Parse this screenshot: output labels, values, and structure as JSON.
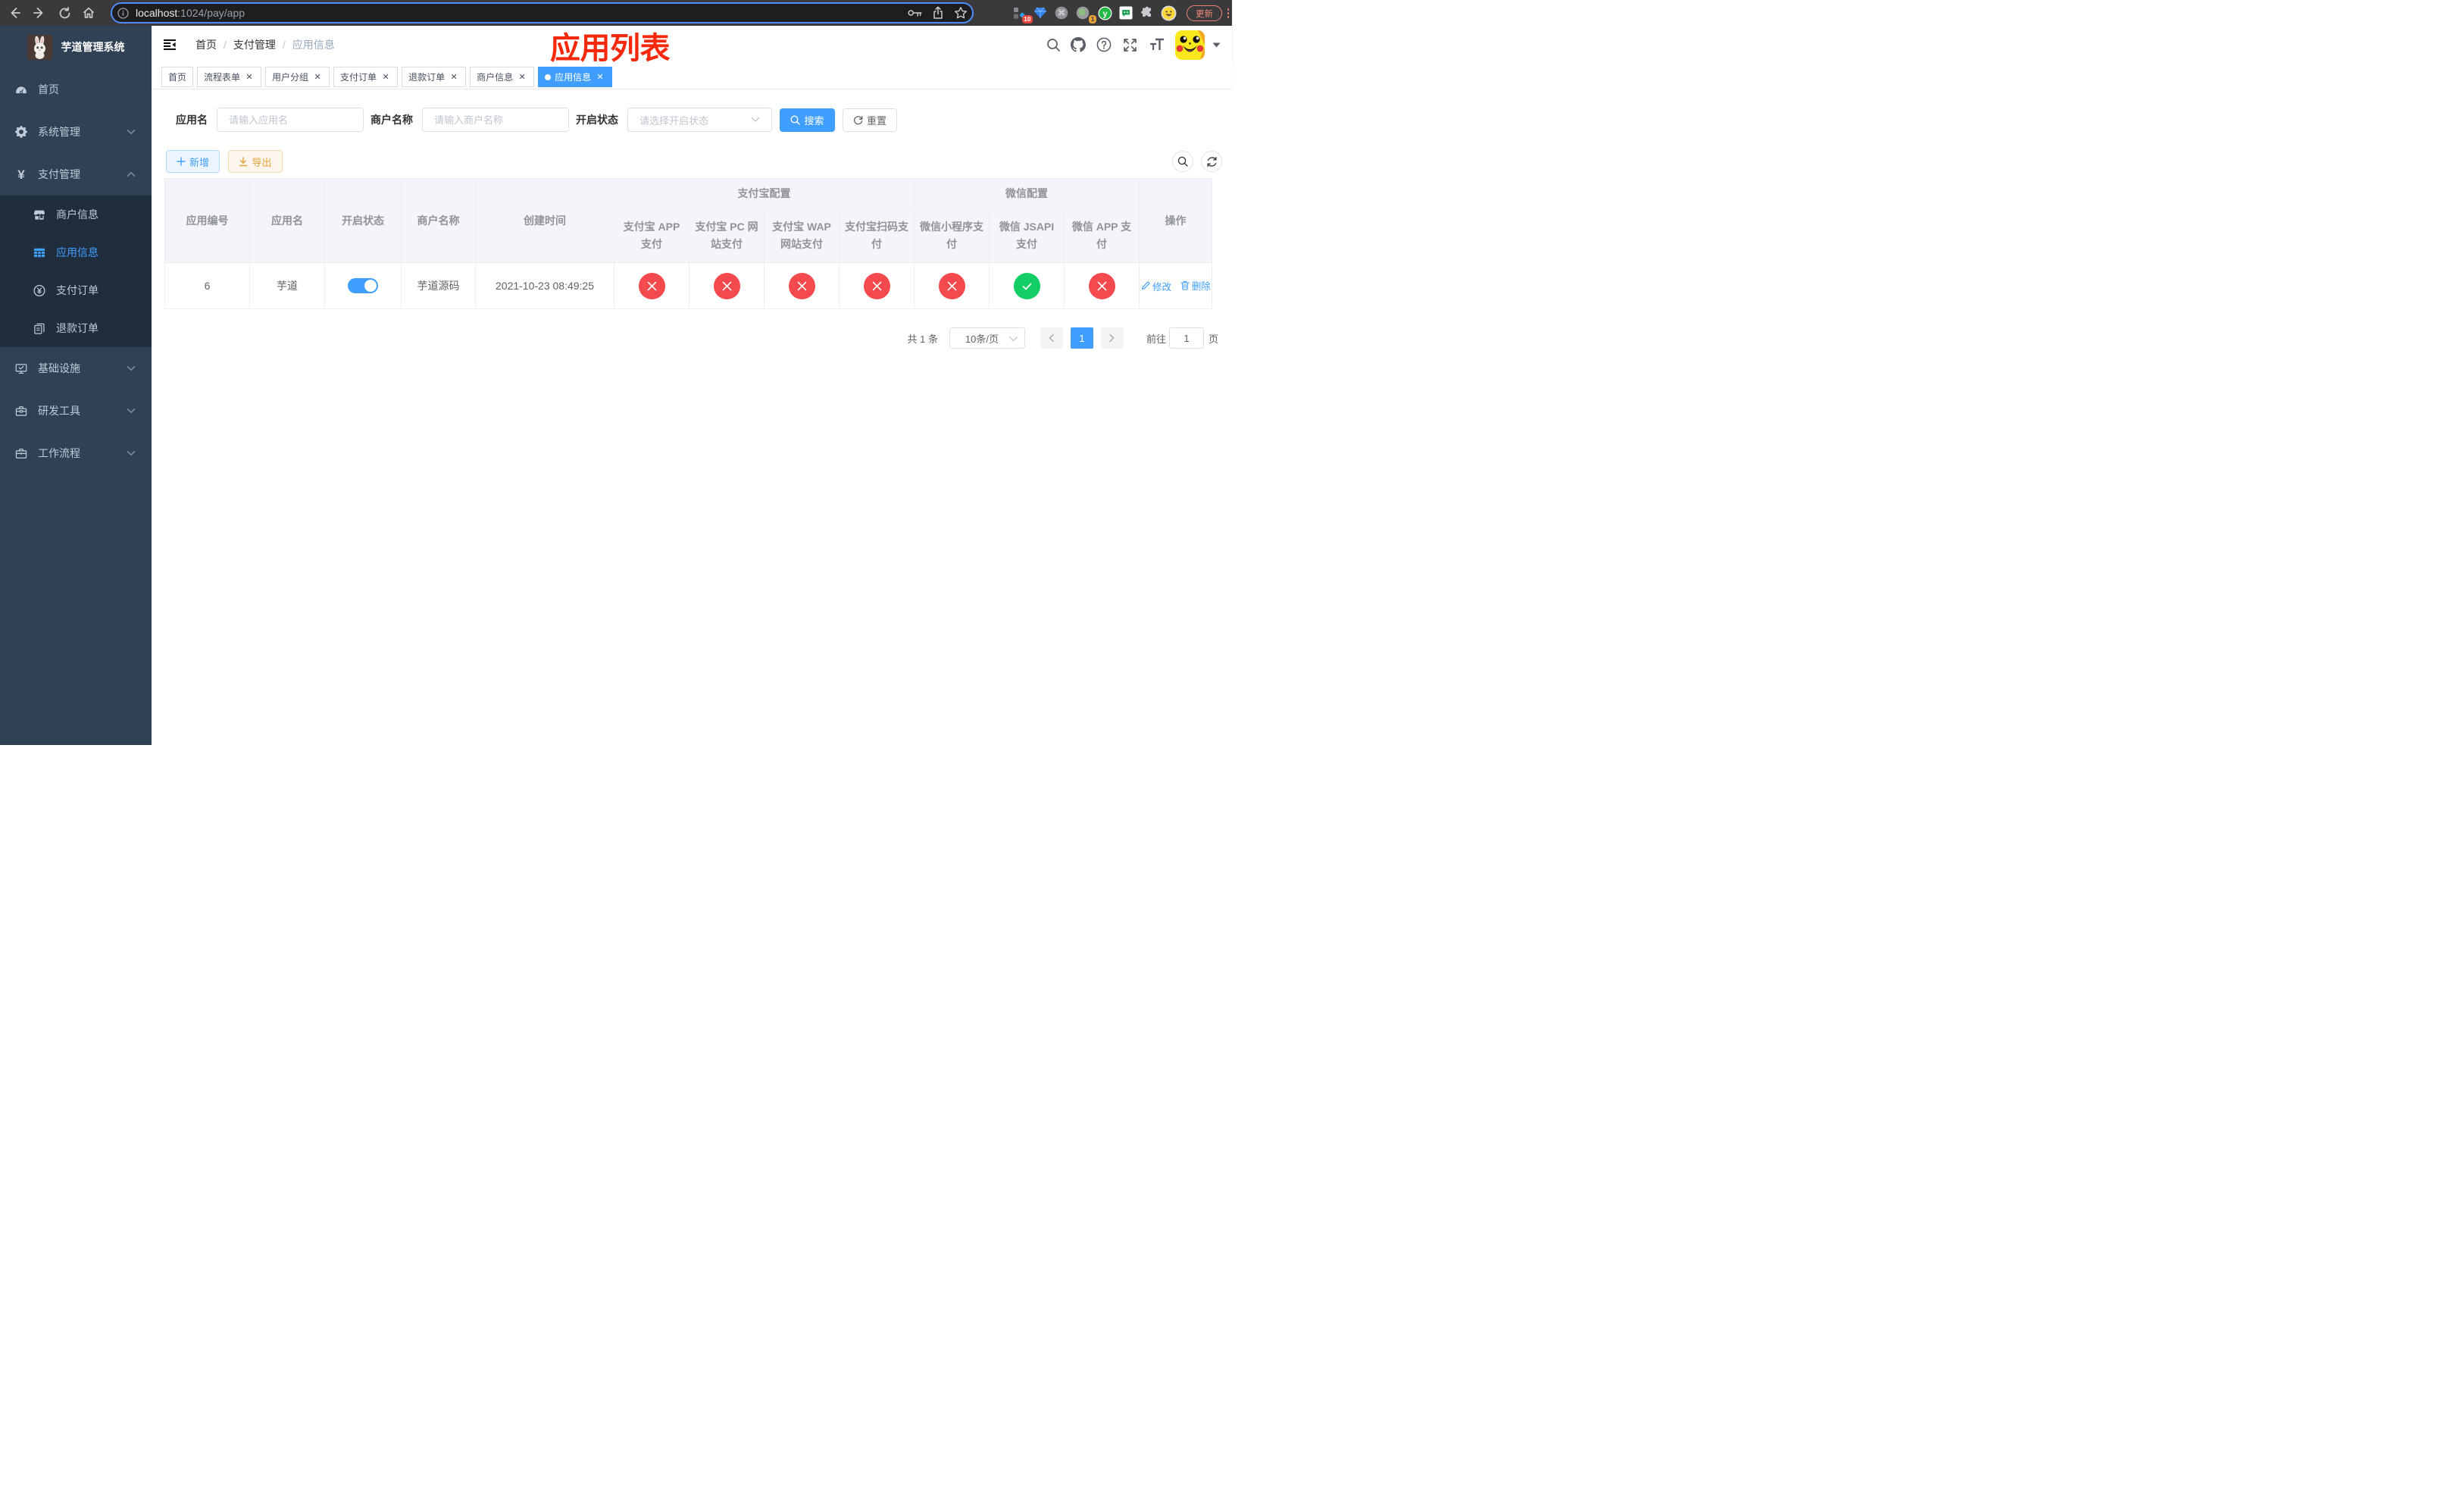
{
  "chrome": {
    "url_host": "localhost",
    "url_path": ":1024/pay/app",
    "ext_badge_red": "10",
    "ext_badge_orange": "1",
    "update_label": "更新"
  },
  "header": {
    "breadcrumb": [
      "首页",
      "支付管理",
      "应用信息"
    ],
    "annotation": "应用列表"
  },
  "sidebar": {
    "title": "芋道管理系统",
    "menu": [
      {
        "label": "首页",
        "icon": "dashboard-icon"
      },
      {
        "label": "系统管理",
        "icon": "gear-icon",
        "arrow": "down"
      },
      {
        "label": "支付管理",
        "icon": "yen-icon",
        "arrow": "up",
        "children": [
          {
            "label": "商户信息",
            "icon": "shop-icon"
          },
          {
            "label": "应用信息",
            "icon": "grid-icon",
            "active": true
          },
          {
            "label": "支付订单",
            "icon": "yen-circle-icon"
          },
          {
            "label": "退款订单",
            "icon": "document-icon"
          }
        ]
      },
      {
        "label": "基础设施",
        "icon": "monitor-icon",
        "arrow": "down"
      },
      {
        "label": "研发工具",
        "icon": "toolbox-icon",
        "arrow": "down"
      },
      {
        "label": "工作流程",
        "icon": "briefcase-icon",
        "arrow": "down"
      }
    ]
  },
  "tags": [
    {
      "label": "首页",
      "closable": false,
      "active": false
    },
    {
      "label": "流程表单",
      "closable": true,
      "active": false
    },
    {
      "label": "用户分组",
      "closable": true,
      "active": false
    },
    {
      "label": "支付订单",
      "closable": true,
      "active": false
    },
    {
      "label": "退款订单",
      "closable": true,
      "active": false
    },
    {
      "label": "商户信息",
      "closable": true,
      "active": false
    },
    {
      "label": "应用信息",
      "closable": true,
      "active": true
    }
  ],
  "filters": {
    "app_name_label": "应用名",
    "app_name_placeholder": "请输入应用名",
    "merchant_label": "商户名称",
    "merchant_placeholder": "请输入商户名称",
    "status_label": "开启状态",
    "status_placeholder": "请选择开启状态",
    "search_label": "搜索",
    "reset_label": "重置"
  },
  "toolbar": {
    "add_label": "新增",
    "export_label": "导出"
  },
  "table": {
    "columns": [
      "应用编号",
      "应用名",
      "开启状态",
      "商户名称",
      "创建时间"
    ],
    "group_alipay": "支付宝配置",
    "group_wechat": "微信配置",
    "alipay_columns": [
      "支付宝 APP 支付",
      "支付宝 PC 网站支付",
      "支付宝 WAP 网站支付",
      "支付宝扫码支付"
    ],
    "wechat_columns": [
      "微信小程序支付",
      "微信 JSAPI 支付",
      "微信 APP 支付"
    ],
    "op_column": "操作",
    "rows": [
      {
        "id": "6",
        "name": "芋道",
        "enabled": true,
        "merchant": "芋道源码",
        "created": "2021-10-23 08:49:25",
        "channels": [
          "no",
          "no",
          "no",
          "no",
          "no",
          "yes",
          "no"
        ],
        "edit_label": "修改",
        "delete_label": "删除"
      }
    ]
  },
  "pagination": {
    "total": "共 1 条",
    "page_size": "10条/页",
    "page": "1",
    "goto_label": "前往",
    "goto_value": "1",
    "page_unit": "页"
  },
  "colors": {
    "primary": "#409eff",
    "success": "#13ce66",
    "danger": "#f4494d",
    "sidebar_bg": "#304156",
    "submenu_bg": "#1f2d3d",
    "annotation_red": "#f6290c"
  }
}
